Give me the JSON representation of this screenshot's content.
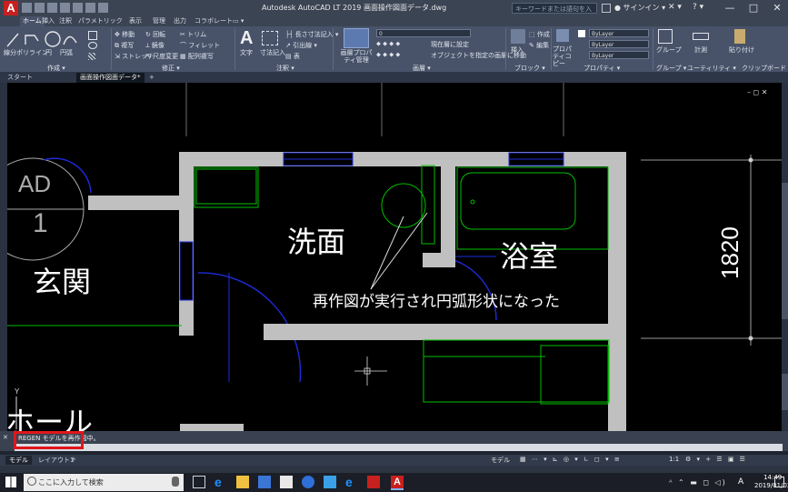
{
  "window": {
    "title": "Autodesk AutoCAD LT 2019    画面操作図面データ.dwg",
    "search_placeholder": "キーワードまたは語句を入力",
    "signin_label": "サインイン",
    "minimize": "—",
    "maximize": "□",
    "close": "✕"
  },
  "menu_tabs": [
    "ホーム",
    "挿入",
    "注釈",
    "パラメトリック",
    "表示",
    "管理",
    "出力",
    "コラボレート",
    "▭ ▾"
  ],
  "ribbon": {
    "draw_tools": [
      "線分",
      "ポリライン",
      "円",
      "円弧"
    ],
    "modify_tools": [
      "移動",
      "回転",
      "トリム",
      "複写",
      "鏡像",
      "フィレット",
      "ストレッチ",
      "尺度変更",
      "配列複写"
    ],
    "annotation_tools": [
      "文字",
      "寸法記入",
      "長さ寸法記入",
      "引出線",
      "表"
    ],
    "layer_tools": [
      "画層プロパティ管理",
      "現在層に設定",
      "オブジェクトを指定の画層に移動"
    ],
    "layer_value": "0",
    "block_tools": [
      "挿入",
      "作成",
      "編集"
    ],
    "property_tools": [
      "プロパティコピー"
    ],
    "bylayer_values": [
      "ByLayer",
      "ByLayer",
      "ByLayer"
    ],
    "group_label": "グループ",
    "utility_label": "計測",
    "clipboard_label": "貼り付け",
    "panels": [
      "作成 ▾",
      "修正 ▾",
      "注釈 ▾",
      "画層 ▾",
      "ブロック ▾",
      "プロパティ ▾",
      "グループ ▾",
      "ユーティリティ ▾",
      "クリップボード ▾"
    ]
  },
  "doc_tabs": [
    "スタート",
    "画面操作図面データ*",
    "+"
  ],
  "drawing": {
    "labels": {
      "senmen": "洗面",
      "yokushitsu": "浴室",
      "genkan": "玄関",
      "hall": "ホール",
      "annotation": "再作図が実行され円弧形状になった",
      "dimension": "1820",
      "section_tag": "AD",
      "section_num": "1"
    },
    "viewport_controls": "– ◻ ✕",
    "side_palette_right": "画層プロパティ管理",
    "side_palette_right2": "プロパティ"
  },
  "command": {
    "history": "REGEN モデルを再作図中。",
    "input_value": ""
  },
  "layout_tabs": [
    "モデル",
    "レイアウト1",
    "+"
  ],
  "status": {
    "model": "モデル",
    "scale": "1:1"
  },
  "taskbar": {
    "search_placeholder": "ここに入力して検索",
    "clock_time": "14:49",
    "clock_date": "2019/01/03",
    "ime": "A"
  },
  "colors": {
    "wall": "#c0c0c0",
    "fixture": "#00c000",
    "door_arc": "#1e2bd9",
    "highlight": "#e0161c"
  }
}
